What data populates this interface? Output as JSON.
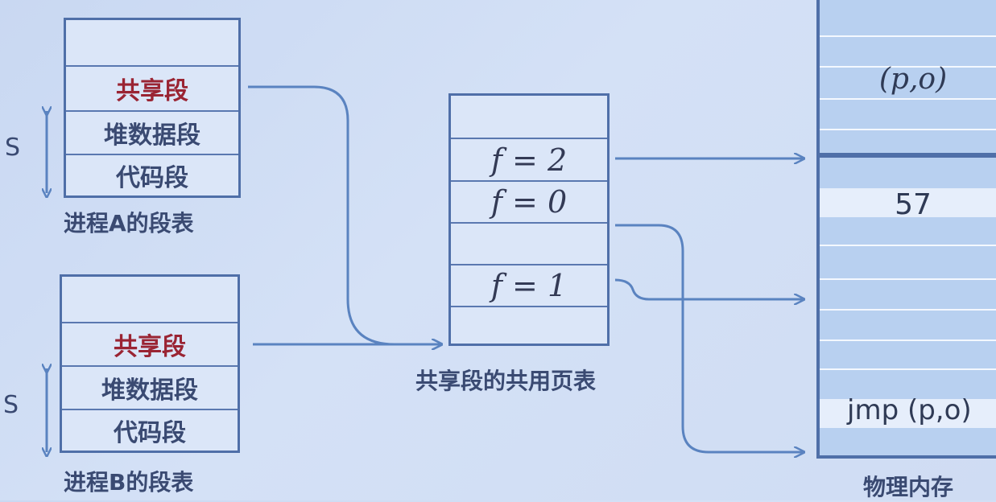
{
  "process_a": {
    "rows": [
      "",
      "共享段",
      "堆数据段",
      "代码段"
    ],
    "caption": "进程A的段表",
    "s_label": "S"
  },
  "process_b": {
    "rows": [
      "",
      "共享段",
      "堆数据段",
      "代码段"
    ],
    "caption": "进程B的段表",
    "s_label": "S"
  },
  "shared_page_table": {
    "rows": [
      "",
      "f = 2",
      "f = 0",
      "",
      "f = 1",
      ""
    ],
    "caption": "共享段的共用页表"
  },
  "physical_memory": {
    "cell_po": "(p,o)",
    "cell_57": "57",
    "cell_jmp": "jmp (p,o)",
    "caption": "物理内存"
  },
  "colors": {
    "table_border": "#4f6fa8",
    "arrow": "#5a83c0",
    "highlight_text": "#9a2433"
  }
}
